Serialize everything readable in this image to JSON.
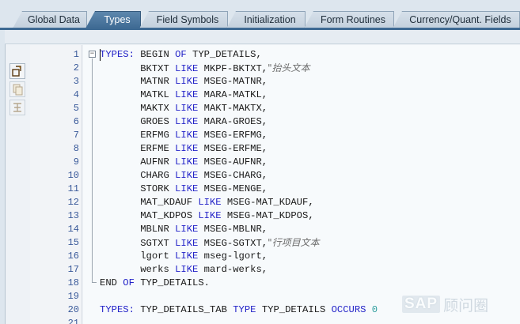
{
  "tabs": [
    {
      "label": "Global Data",
      "active": false
    },
    {
      "label": "Types",
      "active": true
    },
    {
      "label": "Field Symbols",
      "active": false
    },
    {
      "label": "Initialization",
      "active": false
    },
    {
      "label": "Form Routines",
      "active": false
    },
    {
      "label": "Currency/Quant. Fields",
      "active": false
    }
  ],
  "toolbar": {
    "icons": [
      "insert-statement-icon",
      "copy-icon",
      "pattern-icon"
    ]
  },
  "editor": {
    "fold_symbol": "−",
    "lines": [
      {
        "n": "1",
        "parts": [
          {
            "t": "TYPES: ",
            "c": "kw"
          },
          {
            "t": "BEGIN ",
            "c": ""
          },
          {
            "t": "OF ",
            "c": "kw"
          },
          {
            "t": "TYP_DETAILS,",
            "c": ""
          }
        ]
      },
      {
        "n": "2",
        "parts": [
          {
            "t": "       BKTXT ",
            "c": ""
          },
          {
            "t": "LIKE ",
            "c": "kw"
          },
          {
            "t": "MKPF-BKTXT,",
            "c": ""
          },
          {
            "t": "\"抬头文本",
            "c": "cm"
          }
        ]
      },
      {
        "n": "3",
        "parts": [
          {
            "t": "       MATNR ",
            "c": ""
          },
          {
            "t": "LIKE ",
            "c": "kw"
          },
          {
            "t": "MSEG-MATNR,",
            "c": ""
          }
        ]
      },
      {
        "n": "4",
        "parts": [
          {
            "t": "       MATKL ",
            "c": ""
          },
          {
            "t": "LIKE ",
            "c": "kw"
          },
          {
            "t": "MARA-MATKL,",
            "c": ""
          }
        ]
      },
      {
        "n": "5",
        "parts": [
          {
            "t": "       MAKTX ",
            "c": ""
          },
          {
            "t": "LIKE ",
            "c": "kw"
          },
          {
            "t": "MAKT-MAKTX,",
            "c": ""
          }
        ]
      },
      {
        "n": "6",
        "parts": [
          {
            "t": "       GROES ",
            "c": ""
          },
          {
            "t": "LIKE ",
            "c": "kw"
          },
          {
            "t": "MARA-GROES,",
            "c": ""
          }
        ]
      },
      {
        "n": "7",
        "parts": [
          {
            "t": "       ERFMG ",
            "c": ""
          },
          {
            "t": "LIKE ",
            "c": "kw"
          },
          {
            "t": "MSEG-ERFMG,",
            "c": ""
          }
        ]
      },
      {
        "n": "8",
        "parts": [
          {
            "t": "       ERFME ",
            "c": ""
          },
          {
            "t": "LIKE ",
            "c": "kw"
          },
          {
            "t": "MSEG-ERFME,",
            "c": ""
          }
        ]
      },
      {
        "n": "9",
        "parts": [
          {
            "t": "       AUFNR ",
            "c": ""
          },
          {
            "t": "LIKE ",
            "c": "kw"
          },
          {
            "t": "MSEG-AUFNR,",
            "c": ""
          }
        ]
      },
      {
        "n": "10",
        "parts": [
          {
            "t": "       CHARG ",
            "c": ""
          },
          {
            "t": "LIKE ",
            "c": "kw"
          },
          {
            "t": "MSEG-CHARG,",
            "c": ""
          }
        ]
      },
      {
        "n": "11",
        "parts": [
          {
            "t": "       STORK ",
            "c": ""
          },
          {
            "t": "LIKE ",
            "c": "kw"
          },
          {
            "t": "MSEG-MENGE,",
            "c": ""
          }
        ]
      },
      {
        "n": "12",
        "parts": [
          {
            "t": "       MAT_KDAUF ",
            "c": ""
          },
          {
            "t": "LIKE ",
            "c": "kw"
          },
          {
            "t": "MSEG-MAT_KDAUF,",
            "c": ""
          }
        ]
      },
      {
        "n": "13",
        "parts": [
          {
            "t": "       MAT_KDPOS ",
            "c": ""
          },
          {
            "t": "LIKE ",
            "c": "kw"
          },
          {
            "t": "MSEG-MAT_KDPOS,",
            "c": ""
          }
        ]
      },
      {
        "n": "14",
        "parts": [
          {
            "t": "       MBLNR ",
            "c": ""
          },
          {
            "t": "LIKE ",
            "c": "kw"
          },
          {
            "t": "MSEG-MBLNR,",
            "c": ""
          }
        ]
      },
      {
        "n": "15",
        "parts": [
          {
            "t": "       SGTXT ",
            "c": ""
          },
          {
            "t": "LIKE ",
            "c": "kw"
          },
          {
            "t": "MSEG-SGTXT,",
            "c": ""
          },
          {
            "t": "\"行项目文本",
            "c": "cm"
          }
        ]
      },
      {
        "n": "16",
        "parts": [
          {
            "t": "       lgort ",
            "c": ""
          },
          {
            "t": "LIKE ",
            "c": "kw"
          },
          {
            "t": "mseg-lgort,",
            "c": ""
          }
        ]
      },
      {
        "n": "17",
        "parts": [
          {
            "t": "       werks ",
            "c": ""
          },
          {
            "t": "LIKE ",
            "c": "kw"
          },
          {
            "t": "mard-werks,",
            "c": ""
          }
        ]
      },
      {
        "n": "18",
        "parts": [
          {
            "t": "END ",
            "c": ""
          },
          {
            "t": "OF ",
            "c": "kw"
          },
          {
            "t": "TYP_DETAILS.",
            "c": ""
          }
        ]
      },
      {
        "n": "19",
        "parts": []
      },
      {
        "n": "20",
        "parts": [
          {
            "t": "TYPES: ",
            "c": "kw"
          },
          {
            "t": "TYP_DETAILS_TAB ",
            "c": ""
          },
          {
            "t": "TYPE ",
            "c": "kw"
          },
          {
            "t": "TYP_DETAILS ",
            "c": ""
          },
          {
            "t": "OCCURS ",
            "c": "kw"
          },
          {
            "t": "0",
            "c": "num"
          }
        ]
      },
      {
        "n": "21",
        "parts": []
      }
    ]
  },
  "watermark": {
    "brand": "SAP",
    "text": "顾问圈"
  }
}
